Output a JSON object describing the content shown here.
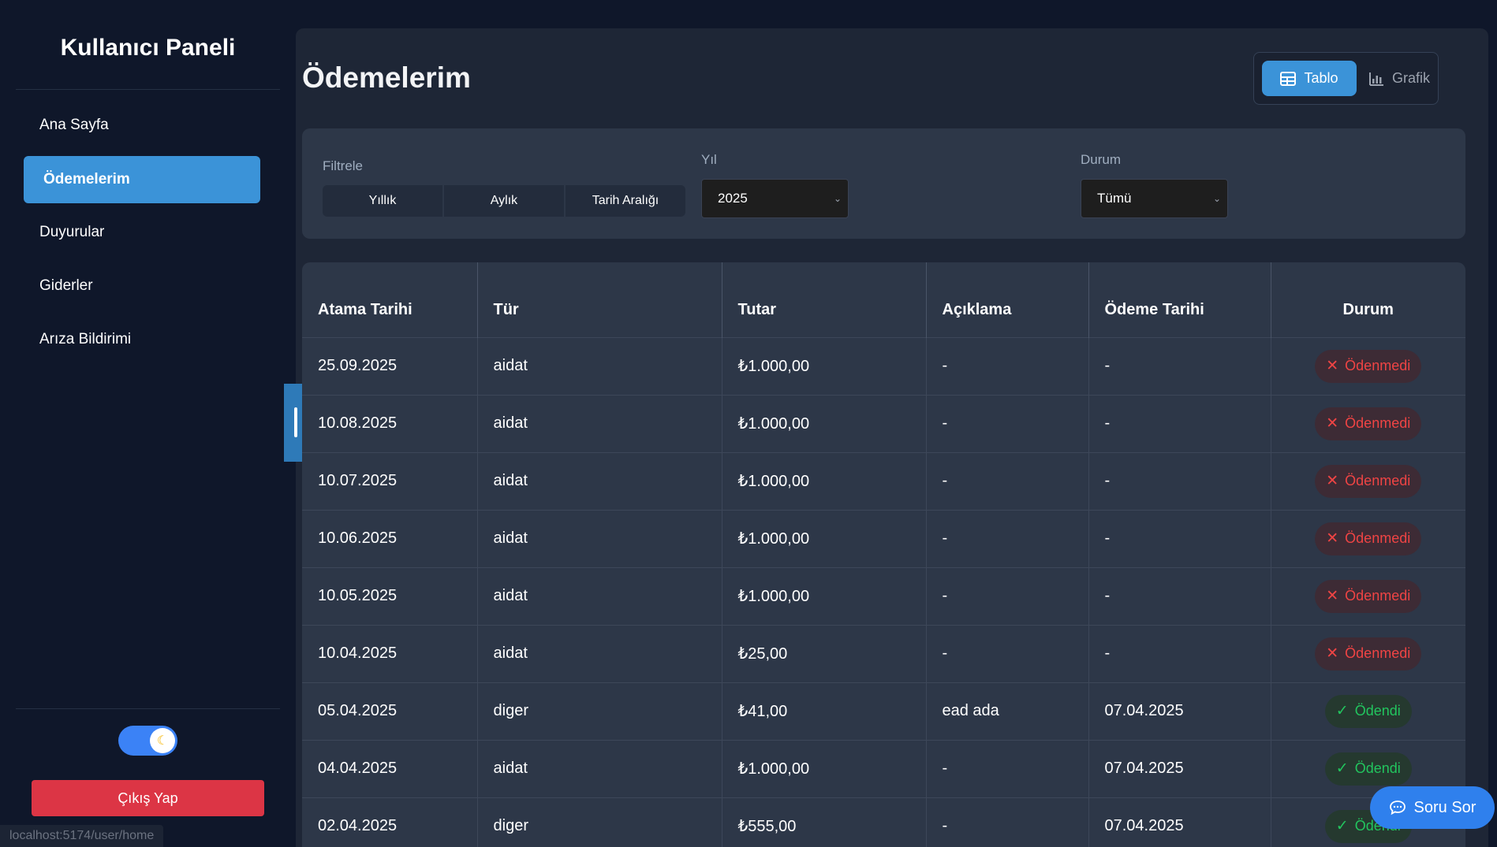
{
  "sidebar": {
    "title": "Kullanıcı Paneli",
    "items": [
      {
        "label": "Ana Sayfa"
      },
      {
        "label": "Ödemelerim"
      },
      {
        "label": "Duyurular"
      },
      {
        "label": "Giderler"
      },
      {
        "label": "Arıza Bildirimi"
      }
    ],
    "active_item": "Ödemelerim",
    "logout_label": "Çıkış Yap",
    "theme_icon": "moon-icon"
  },
  "status_url": "localhost:5174/user/home",
  "page": {
    "title": "Ödemelerim",
    "view_toggle": {
      "table_label": "Tablo",
      "chart_label": "Grafik",
      "active": "Tablo"
    }
  },
  "filters": {
    "filter_label": "Filtrele",
    "segments": [
      "Yıllık",
      "Aylık",
      "Tarih Aralığı"
    ],
    "year_label": "Yıl",
    "year_value": "2025",
    "status_label": "Durum",
    "status_value": "Tümü"
  },
  "table": {
    "headers": [
      "Atama Tarihi",
      "Tür",
      "Tutar",
      "Açıklama",
      "Ödeme Tarihi",
      "Durum"
    ],
    "rows": [
      [
        "25.09.2025",
        "aidat",
        "₺1.000,00",
        "-",
        "-",
        "Ödenmedi"
      ],
      [
        "10.08.2025",
        "aidat",
        "₺1.000,00",
        "-",
        "-",
        "Ödenmedi"
      ],
      [
        "10.07.2025",
        "aidat",
        "₺1.000,00",
        "-",
        "-",
        "Ödenmedi"
      ],
      [
        "10.06.2025",
        "aidat",
        "₺1.000,00",
        "-",
        "-",
        "Ödenmedi"
      ],
      [
        "10.05.2025",
        "aidat",
        "₺1.000,00",
        "-",
        "-",
        "Ödenmedi"
      ],
      [
        "10.04.2025",
        "aidat",
        "₺25,00",
        "-",
        "-",
        "Ödenmedi"
      ],
      [
        "05.04.2025",
        "diger",
        "₺41,00",
        "ead ada",
        "07.04.2025",
        "Ödendi"
      ],
      [
        "04.04.2025",
        "aidat",
        "₺1.000,00",
        "-",
        "07.04.2025",
        "Ödendi"
      ],
      [
        "02.04.2025",
        "diger",
        "₺555,00",
        "-",
        "07.04.2025",
        "Ödendi"
      ]
    ],
    "status_colors": {
      "Ödenmedi": "#ef4444",
      "Ödendi": "#22c55e"
    }
  },
  "help_button": {
    "label": "Soru Sor"
  },
  "colors": {
    "accent": "#3b93d8",
    "logout": "#dc3545",
    "help": "#2f80ed"
  }
}
